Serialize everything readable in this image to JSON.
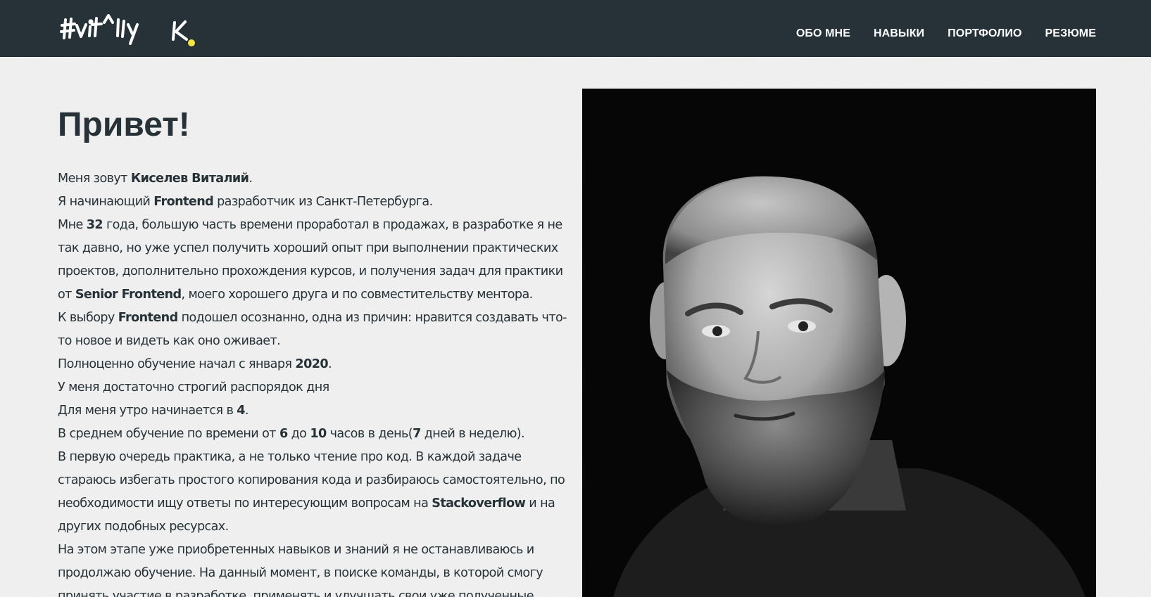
{
  "logo": {
    "text": "#vit^lly K.",
    "dot_color": "#f5e53b"
  },
  "nav": {
    "items": [
      {
        "label": "ОБО МНЕ"
      },
      {
        "label": "НАВЫКИ"
      },
      {
        "label": "ПОРТФОЛИО"
      },
      {
        "label": "РЕЗЮМЕ"
      }
    ]
  },
  "main": {
    "title": "Привет!",
    "lines": [
      [
        "Меня зовут ",
        "Киселев Виталий",
        "."
      ],
      [
        "Я начинающий ",
        "Frontend",
        " разработчик из Санкт-Петербурга."
      ],
      [
        "Мне ",
        "32",
        " года, большую часть времени проработал в продажах, в разработке я не"
      ],
      [
        "так давно, но уже успел получить хороший опыт при выполнении практических"
      ],
      [
        "проектов, дополнительно прохождения курсов, и получения задач для практики"
      ],
      [
        "от ",
        "Senior Frontend",
        ", моего хорошего друга и по совместительству ментора."
      ],
      [
        "К выбору ",
        "Frontend",
        " подошел осознанно, одна из причин: нравится создавать что-"
      ],
      [
        "то новое и видеть как оно оживает."
      ],
      [
        "Полноценно обучение начал с января ",
        "2020",
        "."
      ],
      [
        "У меня достаточно строгий распорядок дня"
      ],
      [
        "Для меня утро начинается в ",
        "4",
        "."
      ],
      [
        "В среднем обучение по времени от ",
        "6",
        " до ",
        "10",
        " часов в день(",
        "7",
        " дней в неделю)."
      ],
      [
        "В первую очередь практика, а не только чтение про код. В каждой задаче"
      ],
      [
        "стараюсь избегать простого копирования кода и разбираюсь самостоятельно, по"
      ],
      [
        "необходимости ищу ответы по интересующим вопросам на ",
        "Stackoverflow",
        " и на"
      ],
      [
        "других подобных ресурсах."
      ],
      [
        "На этом этапе уже приобретенных навыков и знаний я не останавливаюсь и"
      ],
      [
        "продолжаю обучение. На данный момент, в поиске команды, в которой смогу"
      ],
      [
        "принять участие в разработке, применять и улучшать свои уже полученные"
      ]
    ]
  },
  "colors": {
    "header_bg": "#263238",
    "text": "#263238",
    "page_bg": "#f1f1f1",
    "accent": "#f5e53b"
  }
}
